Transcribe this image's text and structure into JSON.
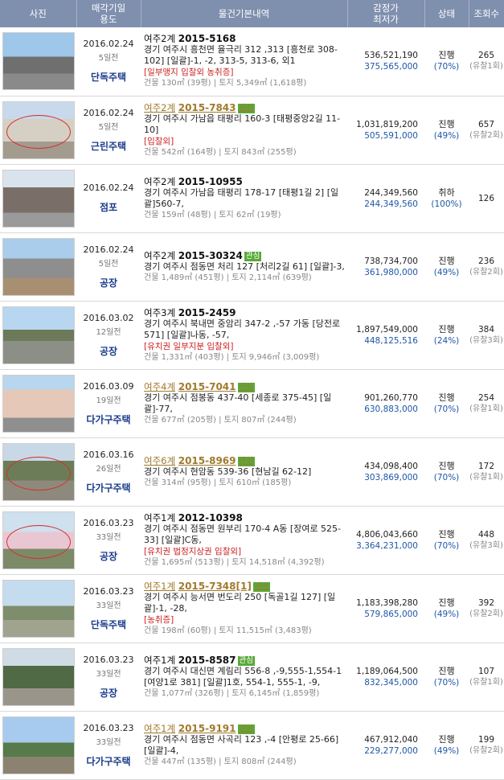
{
  "header": {
    "photo": "사진",
    "sale_date_line1": "매각기일",
    "sale_date_line2": "용도",
    "basic_info": "물건기본내역",
    "price_line1": "감정가",
    "price_line2": "최저가",
    "status": "상태",
    "views": "조회수"
  },
  "rows": [
    {
      "date": "2016.02.24",
      "ago": "5일전",
      "usage": "단독주택",
      "court": "여주2계",
      "case_no": "2015-5168",
      "linked": false,
      "badge": "",
      "addr": "경기 여주시 흥천면 율극리 312 ,313 [흥천로 308-102] [일괄]-1, -2, 313-5, 313-6, 외1",
      "warn": "[일부맹지 입찰외  농취증]",
      "area": "건물 130㎡ (39평) | 토지 5,349㎡ (1,618평)",
      "appraisal": "536,521,190",
      "minimum": "375,565,000",
      "status": "진행",
      "pct": "(70%)",
      "views": "265",
      "fails": "(유찰1회)"
    },
    {
      "date": "2016.02.24",
      "ago": "5일전",
      "usage": "근린주택",
      "court": "여주2계",
      "case_no": "2015-7843",
      "linked": true,
      "badge": "관심",
      "addr": "경기 여주시 가남읍 태평리 160-3 [태평중앙2길 11-10]",
      "warn": "[입찰외]",
      "area": "건물 542㎡ (164평) | 토지 843㎡ (255평)",
      "appraisal": "1,031,819,200",
      "minimum": "505,591,000",
      "status": "진행",
      "pct": "(49%)",
      "views": "657",
      "fails": "(유찰2회)"
    },
    {
      "date": "2016.02.24",
      "ago": "",
      "usage": "점포",
      "court": "여주2계",
      "case_no": "2015-10955",
      "linked": false,
      "badge": "",
      "addr": "경기 여주시 가남읍 태평리 178-17 [태평1길 2] [일괄]560-7,",
      "warn": "",
      "area": "건물 159㎡ (48평) | 토지 62㎡ (19평)",
      "appraisal": "244,349,560",
      "minimum": "244,349,560",
      "status": "취하",
      "pct": "(100%)",
      "views": "126",
      "fails": ""
    },
    {
      "date": "2016.02.24",
      "ago": "5일전",
      "usage": "공장",
      "court": "여주2계",
      "case_no": "2015-30324",
      "linked": false,
      "badge": "관심",
      "addr": "경기 여주시 점동면 처리 127 [처리2길 61]  [일괄]-3,",
      "warn": "",
      "area": "건물 1,489㎡ (451평) | 토지 2,114㎡ (639평)",
      "appraisal": "738,734,700",
      "minimum": "361,980,000",
      "status": "진행",
      "pct": "(49%)",
      "views": "236",
      "fails": "(유찰2회)"
    },
    {
      "date": "2016.03.02",
      "ago": "12일전",
      "usage": "공장",
      "court": "여주3계",
      "case_no": "2015-2459",
      "linked": false,
      "badge": "",
      "addr": "경기 여주시 북내면 중암리 347-2 ,-57 가동 [당전로 571] [일괄]나동, -57,",
      "warn": "[유치권  일부지분 입찰외]",
      "area": "건물 1,331㎡ (403평) | 토지 9,946㎡ (3,009평)",
      "appraisal": "1,897,549,000",
      "minimum": "448,125,516",
      "status": "진행",
      "pct": "(24%)",
      "views": "384",
      "fails": "(유찰3회)"
    },
    {
      "date": "2016.03.09",
      "ago": "19일전",
      "usage": "다가구주택",
      "court": "여주4계",
      "case_no": "2015-7041",
      "linked": true,
      "badge": "관심",
      "addr": "경기 여주시 점봉동 437-40 [세종로 375-45] [일괄]-77,",
      "warn": "",
      "area": "건물 677㎡ (205평) | 토지 807㎡ (244평)",
      "appraisal": "901,260,770",
      "minimum": "630,883,000",
      "status": "진행",
      "pct": "(70%)",
      "views": "254",
      "fails": "(유찰1회)"
    },
    {
      "date": "2016.03.16",
      "ago": "26일전",
      "usage": "다가구주택",
      "court": "여주6계",
      "case_no": "2015-8969",
      "linked": true,
      "badge": "관심",
      "addr": "경기 여주시 현암동 539-36 [현남길 62-12]",
      "warn": "",
      "area": "건물 314㎡ (95평) | 토지 610㎡ (185평)",
      "appraisal": "434,098,400",
      "minimum": "303,869,000",
      "status": "진행",
      "pct": "(70%)",
      "views": "172",
      "fails": "(유찰1회)"
    },
    {
      "date": "2016.03.23",
      "ago": "33일전",
      "usage": "공장",
      "court": "여주1계",
      "case_no": "2012-10398",
      "linked": false,
      "badge": "",
      "addr": "경기 여주시 점동면 원부리 170-4 A동 [장여로 525-33] [일괄]C동,",
      "warn": "[유치권  법정지상권  입찰외]",
      "area": "건물 1,695㎡ (513평) | 토지 14,518㎡ (4,392평)",
      "appraisal": "4,806,043,660",
      "minimum": "3,364,231,000",
      "status": "진행",
      "pct": "(70%)",
      "views": "448",
      "fails": "(유찰3회)"
    },
    {
      "date": "2016.03.23",
      "ago": "33일전",
      "usage": "단독주택",
      "court": "여주1계",
      "case_no": "2015-7348[1]",
      "linked": true,
      "badge": "관심",
      "addr": "경기 여주시 능서면 번도리 250 [독골1길 127] [일괄]-1, -28,",
      "warn": "[농취증]",
      "area": "건물 198㎡ (60평) | 토지 11,515㎡ (3,483평)",
      "appraisal": "1,183,398,280",
      "minimum": "579,865,000",
      "status": "진행",
      "pct": "(49%)",
      "views": "392",
      "fails": "(유찰2회)"
    },
    {
      "date": "2016.03.23",
      "ago": "33일전",
      "usage": "공장",
      "court": "여주1계",
      "case_no": "2015-8587",
      "linked": false,
      "badge": "관심",
      "addr": "경기 여주시 대신면 계림리 556-8 ,-9,555-1,554-1 [여양1로 381] [일괄]1호, 554-1, 555-1, -9,",
      "warn": "",
      "area": "건물 1,077㎡ (326평) | 토지 6,145㎡ (1,859평)",
      "appraisal": "1,189,064,500",
      "minimum": "832,345,000",
      "status": "진행",
      "pct": "(70%)",
      "views": "107",
      "fails": "(유찰1회)"
    },
    {
      "date": "2016.03.23",
      "ago": "33일전",
      "usage": "다가구주택",
      "court": "여주1계",
      "case_no": "2015-9191",
      "linked": true,
      "badge": "관심",
      "addr": "경기 여주시 점동면 사곡리 123 ,-4 [안평로 25-66] [일괄]-4,",
      "warn": "",
      "area": "건물 447㎡ (135평) | 토지 808㎡ (244평)",
      "appraisal": "467,912,040",
      "minimum": "229,277,000",
      "status": "진행",
      "pct": "(49%)",
      "views": "199",
      "fails": "(유찰2회)"
    }
  ]
}
